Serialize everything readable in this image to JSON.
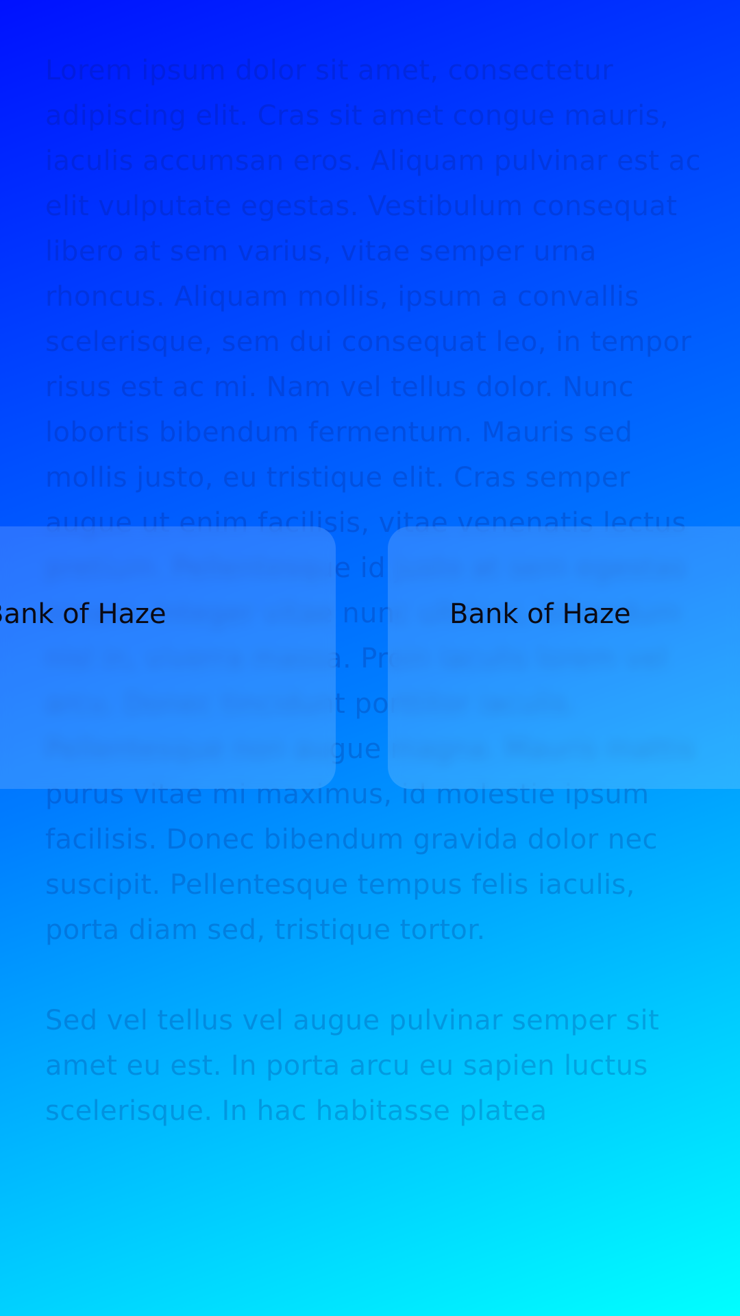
{
  "paragraphs": [
    "Lorem ipsum dolor sit amet, consectetur adipiscing elit. Cras sit amet congue mauris, iaculis accumsan eros. Aliquam pulvinar est ac elit vulputate egestas. Vestibulum consequat libero at sem varius, vitae semper urna rhoncus. Aliquam mollis, ipsum a convallis scelerisque, sem dui consequat leo, in tempor risus est ac mi. Nam vel tellus dolor. Nunc lobortis bibendum fermentum. Mauris sed mollis justo, eu tristique elit. Cras semper augue ut enim facilisis, vitae venenatis lectus pretium. Pellentesque id justo at sem egestas ornare. Integer vitae nunc ultrices, bibendum nisl in, viverra massa. Proin iaculis lorem vel arcu. Donec tincidunt porttitor iaculis. Pellentesque non augue magna. Mauris mattis purus vitae mi maximus, id molestie ipsum facilisis. Donec bibendum gravida dolor nec suscipit. Pellentesque tempus felis iaculis, porta diam sed, tristique tortor.",
    "Sed vel tellus vel augue pulvinar semper sit amet eu est. In porta arcu eu sapien luctus scelerisque. In hac habitasse platea"
  ],
  "cards": [
    {
      "title": "Bank of Haze"
    },
    {
      "title": "Bank of Haze"
    }
  ],
  "colors": {
    "gradient_start": "#0011ff",
    "gradient_end": "#00ffff",
    "card_title": "#0a0a14"
  }
}
